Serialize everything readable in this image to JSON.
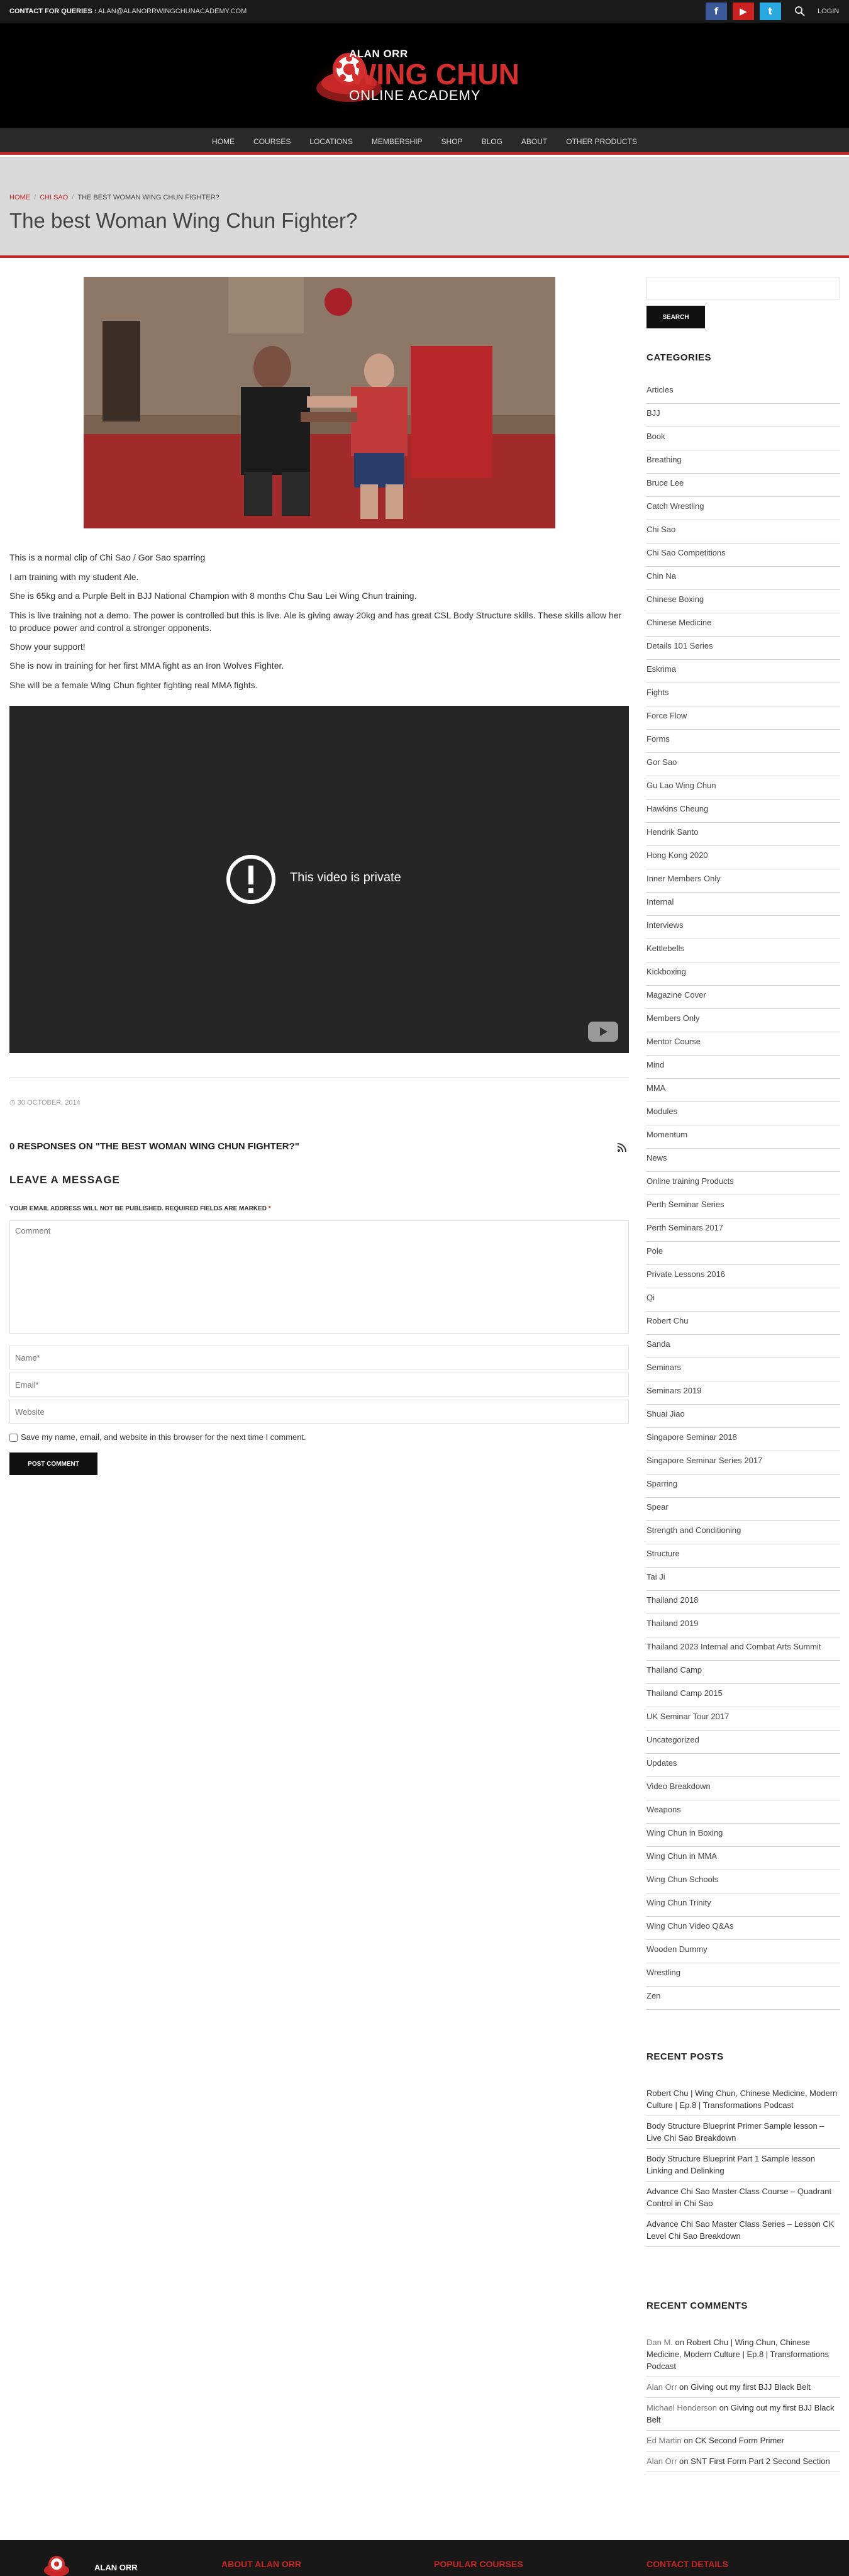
{
  "topbar": {
    "contact_label": "CONTACT FOR QUERIES :",
    "contact_email": "ALAN@ALANORRWINGCHUNACADEMY.COM",
    "facebook_icon": "f",
    "youtube_icon": "▶",
    "twitter_icon": "t",
    "login": "LOGIN"
  },
  "logo": {
    "line1": "ALAN ORR",
    "line2": "WING CHUN",
    "line3": "ONLINE ACADEMY",
    "accent": "#d32f2f"
  },
  "nav": {
    "items": [
      "HOME",
      "COURSES",
      "LOCATIONS",
      "MEMBERSHIP",
      "SHOP",
      "BLOG",
      "ABOUT",
      "OTHER PRODUCTS"
    ]
  },
  "breadcrumb": {
    "home": "HOME",
    "category": "CHI SAO",
    "current": "THE BEST WOMAN WING CHUN FIGHTER?",
    "sep": "/"
  },
  "page": {
    "title": "The best Woman Wing Chun Fighter?"
  },
  "post": {
    "paragraphs": [
      "This is a normal clip of Chi Sao / Gor Sao sparring",
      "I am training with my student Ale.",
      "She is 65kg and a Purple Belt in BJJ National Champion with 8 months Chu Sau Lei Wing Chun training.",
      "This is live training not a demo. The power is controlled but this is live. Ale is giving away 20kg and has great CSL Body Structure skills. These skills allow her to produce power and control a stronger opponents.",
      "Show your support!",
      "She is now in training for her first MMA fight as an Iron Wolves Fighter.",
      "She will be a female Wing Chun fighter fighting real MMA fights."
    ],
    "video_text": "This video is private",
    "date": "30 OCTOBER, 2014"
  },
  "comments": {
    "responses_title": "0 RESPONSES ON \"THE BEST WOMAN WING CHUN FIGHTER?\"",
    "leave_title": "LEAVE A MESSAGE",
    "required_note": "YOUR EMAIL ADDRESS WILL NOT BE PUBLISHED. REQUIRED FIELDS ARE MARKED",
    "required_star": "*",
    "comment_placeholder": "Comment",
    "name_placeholder": "Name*",
    "email_placeholder": "Email*",
    "website_placeholder": "Website",
    "save_label": "Save my name, email, and website in this browser for the next time I comment.",
    "post_button": "POST COMMENT"
  },
  "sidebar": {
    "search_button": "SEARCH",
    "categories_title": "CATEGORIES",
    "categories": [
      "Articles",
      "BJJ",
      "Book",
      "Breathing",
      "Bruce Lee",
      "Catch Wrestling",
      "Chi Sao",
      "Chi Sao Competitions",
      "Chin Na",
      "Chinese Boxing",
      "Chinese Medicine",
      "Details 101 Series",
      "Eskrima",
      "Fights",
      "Force Flow",
      "Forms",
      "Gor Sao",
      "Gu Lao Wing Chun",
      "Hawkins Cheung",
      "Hendrik Santo",
      "Hong Kong 2020",
      "Inner Members Only",
      "Internal",
      "Interviews",
      "Kettlebells",
      "Kickboxing",
      "Magazine Cover",
      "Members Only",
      "Mentor Course",
      "Mind",
      "MMA",
      "Modules",
      "Momentum",
      "News",
      "Online training Products",
      "Perth Seminar Series",
      "Perth Seminars 2017",
      "Pole",
      "Private Lessons 2016",
      "Qi",
      "Robert Chu",
      "Sanda",
      "Seminars",
      "Seminars 2019",
      "Shuai Jiao",
      "Singapore Seminar 2018",
      "Singapore Seminar Series 2017",
      "Sparring",
      "Spear",
      "Strength and Conditioning",
      "Structure",
      "Tai Ji",
      "Thailand 2018",
      "Thailand 2019",
      "Thailand 2023 Internal and Combat Arts Summit",
      "Thailand Camp",
      "Thailand Camp 2015",
      "UK Seminar Tour 2017",
      "Uncategorized",
      "Updates",
      "Video Breakdown",
      "Weapons",
      "Wing Chun in Boxing",
      "Wing Chun in MMA",
      "Wing Chun Schools",
      "Wing Chun Trinity",
      "Wing Chun Video Q&As",
      "Wooden Dummy",
      "Wrestling",
      "Zen"
    ],
    "recent_posts_title": "RECENT POSTS",
    "recent_posts": [
      "Robert Chu | Wing Chun, Chinese Medicine, Modern Culture | Ep.8 | Transformations Podcast",
      "Body Structure Blueprint Primer Sample lesson – Live Chi Sao Breakdown",
      "Body Structure Blueprint Part 1 Sample lesson Linking and Delinking",
      "Advance Chi Sao Master Class Course – Quadrant Control in Chi Sao",
      "Advance Chi Sao Master Class Series – Lesson CK Level Chi Sao Breakdown"
    ],
    "recent_comments_title": "RECENT COMMENTS",
    "recent_comments": [
      {
        "author": "Dan M.",
        "on": "on",
        "post": "Robert Chu | Wing Chun, Chinese Medicine, Modern Culture | Ep.8 | Transformations Podcast"
      },
      {
        "author": "Alan Orr",
        "on": "on",
        "post": "Giving out my first BJJ Black Belt"
      },
      {
        "author": "Michael Henderson",
        "on": "on",
        "post": "Giving out my first BJJ Black Belt"
      },
      {
        "author": "Ed Martin",
        "on": "on",
        "post": "CK Second Form Primer"
      },
      {
        "author": "Alan Orr",
        "on": "on",
        "post": "SNT First Form Part 2 Second Section"
      }
    ]
  },
  "footer": {
    "logo_text": "ALAN ORR",
    "col1": "ABOUT ALAN ORR",
    "col2": "POPULAR COURSES",
    "col3": "CONTACT DETAILS"
  }
}
